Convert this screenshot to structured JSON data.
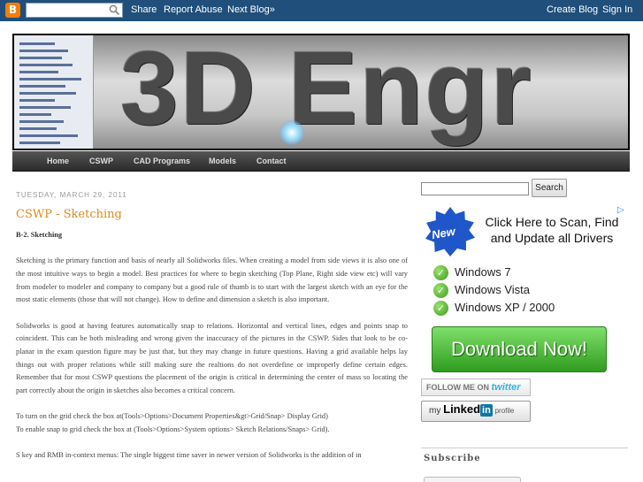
{
  "navbar": {
    "logo_letter": "B",
    "search_placeholder": "",
    "share": "Share",
    "report_abuse": "Report Abuse",
    "next_blog": "Next Blog»",
    "create_blog": "Create Blog",
    "sign_in": "Sign In"
  },
  "header": {
    "title": "3D Engr"
  },
  "tabs": [
    "Home",
    "CSWP",
    "CAD Programs",
    "Models",
    "Contact"
  ],
  "post": {
    "date": "TUESDAY, MARCH 29, 2011",
    "title": "CSWP - Sketching",
    "subheading": "B-2. Sketching",
    "paragraphs": [
      "Sketching is the primary function and basis of nearly all Solidworks files. When creating a model from side views it is also one of the most intuitive ways to begin a model. Best practices for where to begin sketching (Top Plane, Right side view etc) will vary from modeler to modeler and company to company but a good rule of thumb is to start with the largest sketch with an eye for the most static elements (those that will not change). How to define and dimension a sketch is also important.",
      "Solidworks is good at having features automatically snap to relations. Horizontal and vertical lines, edges and points snap to coincident. This can be both misleading and wrong given the inaccuracy of the pictures in the CSWP. Sides that look to be co-planar in the exam question figure may be just that, but they may change in future questions. Having a grid available helps lay things out with proper relations while still making sure the realtions do not overdefine or improperly define certain edges. Remember that for most CSWP questions the placement of the origin is critical in determining the center of mass so locating the part correctly about the origin in sketches also becomes a critical concern."
    ],
    "grid_line_1": "To turn on the grid check the box at(Tools>Options>Document Properties&gt>Grid/Snap> Display Grid)",
    "grid_line_2": "To enable snap to grid check the box at (Tools>Options>System options> Sketch Relations/Snaps> Grid).",
    "last_line": "S key and RMB in-context menus: The single biggest time saver in newer version of Solidworks is the addition of in"
  },
  "sidebar": {
    "search_button": "Search",
    "ad": {
      "badge": "New",
      "headline": "Click Here to Scan, Find and Update all Drivers",
      "items": [
        "Windows  7",
        "Windows  Vista",
        "Windows  XP / 2000"
      ],
      "download": "Download Now!"
    },
    "twitter": {
      "prefix": "FOLLOW ME ON",
      "brand": "twitter"
    },
    "linkedin": {
      "prefix": "my",
      "brand": "Linked",
      "in": "in",
      "suffix": "profile"
    },
    "subscribe_title": "Subscribe"
  }
}
